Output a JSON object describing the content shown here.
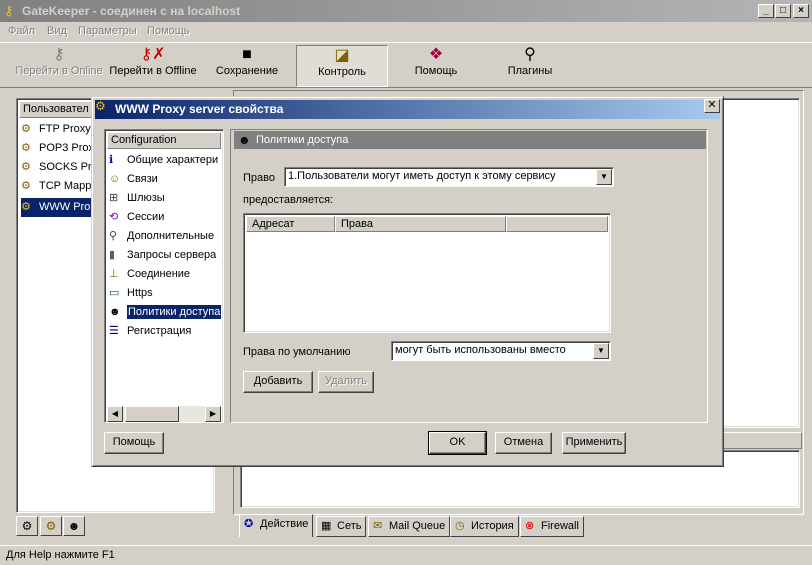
{
  "app": {
    "title": "GateKeeper - соединен с на localhost",
    "controls": {
      "minimize": "_",
      "maximize": "□",
      "close": "×"
    }
  },
  "menu": [
    "Файл",
    "Вид",
    "Параметры",
    "Помощь"
  ],
  "toolbar": [
    {
      "label": "Перейти в Online",
      "icon": "key-icon",
      "glyph": "⚷",
      "disabled": true
    },
    {
      "label": "Перейти в Offline",
      "icon": "key-x-icon",
      "glyph": "✗",
      "disabled": false
    },
    {
      "label": "Сохранение",
      "icon": "floppy-icon",
      "glyph": "▪",
      "disabled": false
    },
    {
      "label": "Контроль",
      "icon": "control-icon",
      "glyph": "◪",
      "disabled": false,
      "active": true
    },
    {
      "label": "Помощь",
      "icon": "help-book-icon",
      "glyph": "❖",
      "disabled": false
    },
    {
      "label": "Плагины",
      "icon": "plug-icon",
      "glyph": "⚲",
      "disabled": false
    }
  ],
  "left_panel": {
    "header": "Пользовател",
    "items": [
      {
        "label": "FTP Proxy"
      },
      {
        "label": "POP3 Prox"
      },
      {
        "label": "SOCKS Pr"
      },
      {
        "label": "TCP Mapp"
      },
      {
        "label": "WWW Pro",
        "selected": true
      }
    ]
  },
  "bottom_tabs": [
    {
      "label": "Действие",
      "icon": "action-icon",
      "glyph": "✪",
      "active": true
    },
    {
      "label": "Сеть",
      "icon": "network-icon",
      "glyph": "▦"
    },
    {
      "label": "Mail Queue",
      "icon": "mail-icon",
      "glyph": "✉"
    },
    {
      "label": "История",
      "icon": "history-clock-icon",
      "glyph": "◷"
    },
    {
      "label": "Firewall",
      "icon": "firewall-icon",
      "glyph": "⊗"
    }
  ],
  "status": {
    "text": "Для Help нажмите F1"
  },
  "dialog": {
    "title": "WWW Proxy server свойства",
    "config_header": "Configuration",
    "config_items": [
      {
        "label": "Общие характери",
        "icon": "info-icon",
        "glyph": "ℹ",
        "color": "#0000c0"
      },
      {
        "label": "Связи",
        "icon": "links-icon",
        "glyph": "☺",
        "color": "#806000"
      },
      {
        "label": "Шлюзы",
        "icon": "gateway-icon",
        "glyph": "⊞",
        "color": "#404040"
      },
      {
        "label": "Сессии",
        "icon": "sessions-icon",
        "glyph": "⟲",
        "color": "#8000c0"
      },
      {
        "label": "Дополнительные",
        "icon": "plug-icon",
        "glyph": "⚲",
        "color": "#404040"
      },
      {
        "label": "Запросы сервера",
        "icon": "server-icon",
        "glyph": "▮",
        "color": "#606060"
      },
      {
        "label": "Соединение",
        "icon": "connection-icon",
        "glyph": "⊥",
        "color": "#806000"
      },
      {
        "label": "Https",
        "icon": "https-icon",
        "glyph": "▭",
        "color": "#006000"
      },
      {
        "label": "Политики доступа",
        "icon": "policy-icon",
        "glyph": "☻",
        "color": "#000000",
        "selected": true
      },
      {
        "label": "Регистрация",
        "icon": "register-icon",
        "glyph": "☰",
        "color": "#000080"
      }
    ],
    "page_title": "Политики доступа",
    "pravo_label": "Право",
    "pravo_value": "1.Пользователи могут иметь доступ к этому сервису",
    "provides_label": "предоставляется:",
    "columns": [
      "Адресат",
      "Права"
    ],
    "default_label": "Права по умолчанию",
    "default_value": "могут быть использованы вместо",
    "add_button": "Добавить",
    "delete_button": "Удалить",
    "help_button": "Помощь",
    "ok_button": "OK",
    "cancel_button": "Отмена",
    "apply_button": "Применить"
  }
}
